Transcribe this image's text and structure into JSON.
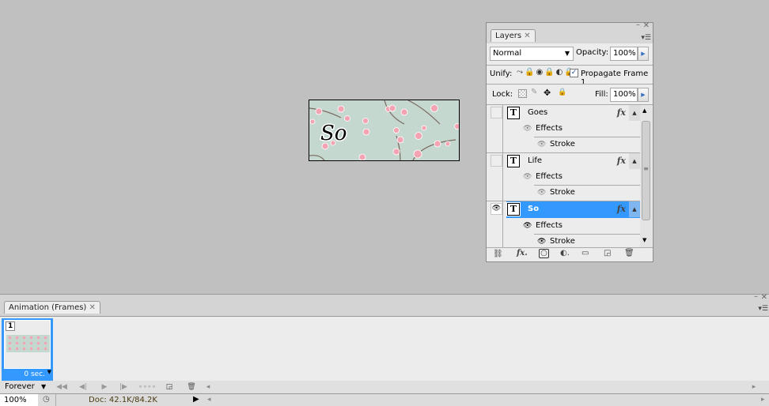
{
  "canvas": {
    "text": "So",
    "background": "#c5d8d0",
    "blossom_color": "#f4a3b3"
  },
  "layers_panel": {
    "tab": "Layers",
    "blend_mode": "Normal",
    "opacity_label": "Opacity:",
    "opacity": "100%",
    "unify_label": "Unify:",
    "propagate_label": "Propagate Frame 1",
    "propagate_checked": true,
    "lock_label": "Lock:",
    "fill_label": "Fill:",
    "fill": "100%",
    "layers": [
      {
        "name": "Goes",
        "visible": false,
        "selected": false,
        "effects": "Effects",
        "stroke": "Stroke"
      },
      {
        "name": "Life",
        "visible": false,
        "selected": false,
        "effects": "Effects",
        "stroke": "Stroke"
      },
      {
        "name": "So",
        "visible": true,
        "selected": true,
        "effects": "Effects",
        "stroke": "Stroke"
      }
    ],
    "fx_label": "fx",
    "selected_color": "#3399ff"
  },
  "animation_panel": {
    "tab": "Animation (Frames)",
    "frames": [
      {
        "number": "1",
        "delay": "0 sec."
      }
    ],
    "loop": "Forever"
  },
  "status": {
    "zoom": "100%",
    "doc": "Doc: 42.1K/84.2K"
  }
}
